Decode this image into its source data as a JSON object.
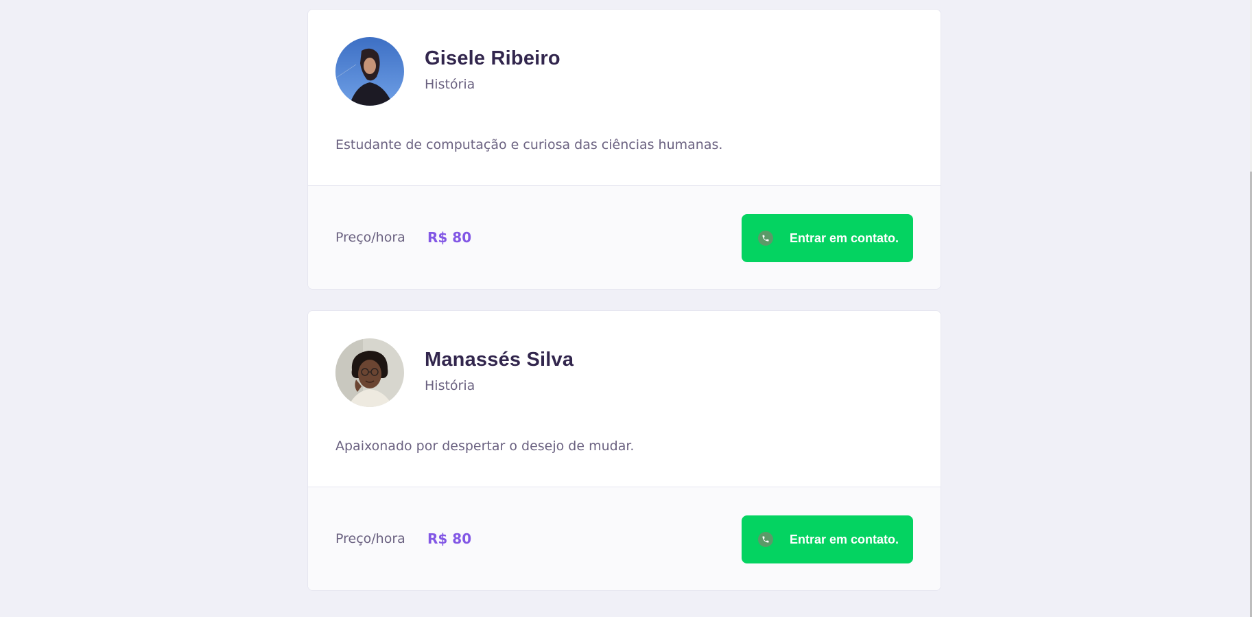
{
  "teachers": [
    {
      "name": "Gisele Ribeiro",
      "subject": "História",
      "bio": "Estudante de computação e curiosa das ciências humanas.",
      "price_label": "Preço/hora",
      "price": "R$ 80",
      "contact_label": "Entrar em contato."
    },
    {
      "name": "Manassés Silva",
      "subject": "História",
      "bio": "Apaixonado por despertar o desejo de mudar.",
      "price_label": "Preço/hora",
      "price": "R$ 80",
      "contact_label": "Entrar em contato."
    }
  ],
  "icons": {
    "contact": "whatsapp-phone-icon"
  },
  "colors": {
    "background": "#f0f0f7",
    "card": "#ffffff",
    "card_footer": "#fafafc",
    "title": "#32264d",
    "text": "#6a6180",
    "price": "#8257e5",
    "button": "#04d361"
  }
}
